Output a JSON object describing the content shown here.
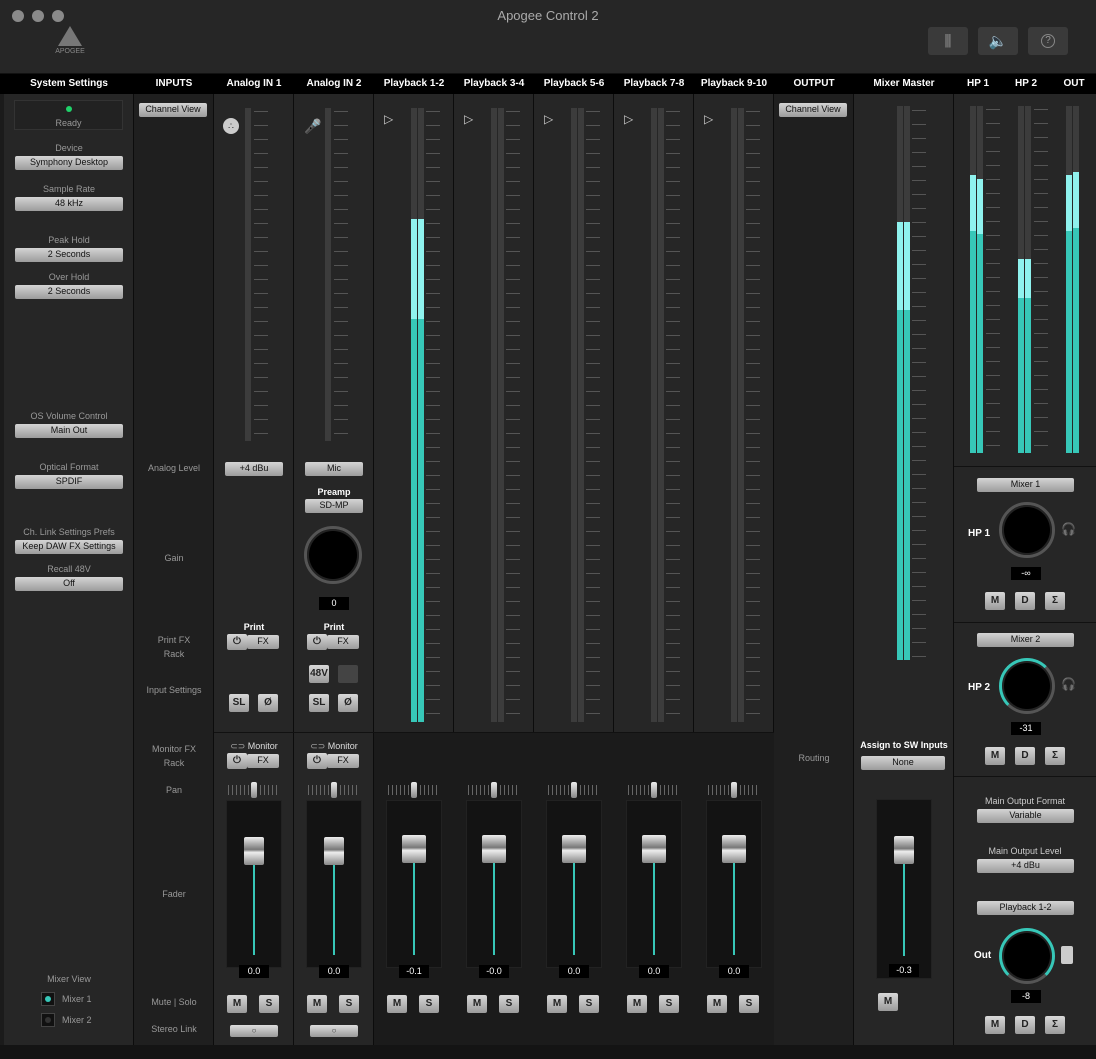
{
  "window": {
    "title": "Apogee Control 2",
    "logo_text": "APOGEE"
  },
  "colors": {
    "accent": "#37c7b8",
    "meter_light": "#8ff2ee",
    "peak": "#e07040",
    "ready": "#1fd26a"
  },
  "headers": [
    "System Settings",
    "INPUTS",
    "Analog IN 1",
    "Analog IN 2",
    "Playback 1-2",
    "Playback 3-4",
    "Playback 5-6",
    "Playback 7-8",
    "Playback 9-10",
    "OUTPUT",
    "Mixer Master",
    "HP 1",
    "HP 2",
    "OUT"
  ],
  "system": {
    "status": "Ready",
    "device_label": "Device",
    "device": "Symphony Desktop",
    "sample_rate_label": "Sample Rate",
    "sample_rate": "48 kHz",
    "peak_hold_label": "Peak Hold",
    "peak_hold": "2 Seconds",
    "over_hold_label": "Over Hold",
    "over_hold": "2 Seconds",
    "os_volume_label": "OS Volume Control",
    "os_volume": "Main Out",
    "optical_label": "Optical Format",
    "optical": "SPDIF",
    "chlink_label": "Ch. Link Settings Prefs",
    "chlink": "Keep DAW FX Settings",
    "recall48_label": "Recall 48V",
    "recall48": "Off",
    "mixer_view_label": "Mixer View",
    "mixer1": "Mixer 1",
    "mixer2": "Mixer 2"
  },
  "inputs_col": {
    "channel_view": "Channel View",
    "analog_level": "Analog Level",
    "gain": "Gain",
    "print_fx_1": "Print FX",
    "print_fx_2": "Rack",
    "input_settings": "Input Settings",
    "monitor_fx_1": "Monitor FX",
    "monitor_fx_2": "Rack",
    "pan": "Pan",
    "fader": "Fader",
    "mute_solo": "Mute | Solo",
    "stereo_link": "Stereo Link"
  },
  "meter_scale": [
    "0",
    "3",
    "6",
    "9",
    "12",
    "15",
    "18",
    "24",
    "30",
    "36",
    "42",
    "48",
    "54",
    "60"
  ],
  "fader_scale": [
    "6",
    "3",
    "0",
    "3",
    "10",
    "20",
    "30",
    "40"
  ],
  "analog1": {
    "level": "+4 dBu",
    "print": "Print",
    "fx": "FX",
    "sl": "SL",
    "phase": "Ø",
    "monitor": "Monitor",
    "fader": "0.0",
    "m": "M",
    "s": "S",
    "meter": 0
  },
  "analog2": {
    "level": "Mic",
    "preamp_label": "Preamp",
    "preamp": "SD-MP",
    "gain": "0",
    "print": "Print",
    "fx": "FX",
    "p48": "48V",
    "sl": "SL",
    "phase": "Ø",
    "monitor": "Monitor",
    "fader": "0.0",
    "m": "M",
    "s": "S",
    "meter": 0
  },
  "playbacks": [
    {
      "fader": "-0.1",
      "m": "M",
      "s": "S",
      "meter": 0.82
    },
    {
      "fader": "-0.0",
      "m": "M",
      "s": "S",
      "meter": 0
    },
    {
      "fader": "0.0",
      "m": "M",
      "s": "S",
      "meter": 0
    },
    {
      "fader": "0.0",
      "m": "M",
      "s": "S",
      "meter": 0
    },
    {
      "fader": "0.0",
      "m": "M",
      "s": "S",
      "meter": 0
    }
  ],
  "output_col": {
    "channel_view": "Channel View",
    "routing": "Routing"
  },
  "master": {
    "assign_label": "Assign to SW Inputs",
    "assign": "None",
    "fader": "-0.3",
    "m": "M",
    "meter": 0.79
  },
  "hp1": {
    "mixer": "Mixer 1",
    "label": "HP 1",
    "value": "-∞",
    "m": "M",
    "d": "D",
    "sum": "Σ"
  },
  "hp2": {
    "mixer": "Mixer 2",
    "label": "HP 2",
    "value": "-31",
    "m": "M",
    "d": "D",
    "sum": "Σ"
  },
  "out": {
    "format_label": "Main Output Format",
    "format": "Variable",
    "level_label": "Main Output Level",
    "level": "+4 dBu",
    "source": "Playback 1-2",
    "label": "Out",
    "value": "-8",
    "m": "M",
    "d": "D",
    "sum": "Σ"
  }
}
